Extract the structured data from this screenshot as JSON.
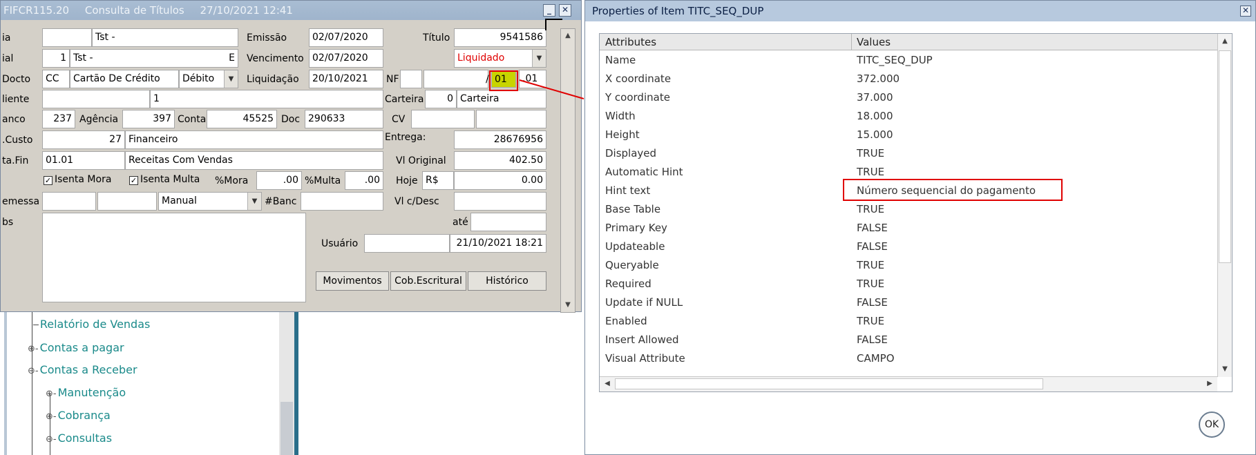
{
  "form": {
    "title_code": "FIFCR115.20",
    "title_name": "Consulta de Títulos",
    "title_datetime": "27/10/2021 12:41",
    "minimize_glyph": "_",
    "close_glyph": "✕",
    "labels": {
      "empresa": "ia",
      "filial": "ial",
      "docto": "Docto",
      "cliente": "liente",
      "banco": "anco",
      "ccusto": ".Custo",
      "contafin": "ta.Fin",
      "remessa": "emessa",
      "obs": "bs",
      "emissao": "Emissão",
      "vencimento": "Vencimento",
      "liquidacao": "Liquidação",
      "titulo": "Título",
      "nf": "NF",
      "carteira": "Carteira",
      "cv": "CV",
      "entrega": "Entrega:",
      "vl_original": "Vl Original",
      "hoje": "Hoje",
      "vl_cdesc": "Vl c/Desc",
      "ate": "até",
      "usuario": "Usuário",
      "agencia": "Agência",
      "conta": "Conta",
      "doc": "Doc",
      "pct_mora": "%Mora",
      "pct_multa": "%Multa",
      "banc": "#Banc",
      "slash": "/"
    },
    "values": {
      "empresa_name": "Tst -",
      "empresa_e": "E",
      "filial_num": "1",
      "filial_name": "Tst -",
      "filial_e": "E",
      "docto_code": "CC",
      "docto_name": "Cartão De Crédito",
      "docto_type": "Débito",
      "cliente_extra": "1",
      "banco_num": "237",
      "agencia_num": "397",
      "conta_num": "45525",
      "doc_num": "290633",
      "ccusto_num": "27",
      "ccusto_name": "Financeiro",
      "contafin_code": "01.01",
      "contafin_name": "Receitas Com Vendas",
      "emissao": "02/07/2020",
      "vencimento": "02/07/2020",
      "liquidacao": "20/10/2021",
      "titulo": "9541586",
      "status": "Liquidado",
      "seq": "01",
      "seq2": ".01",
      "carteira_num": "0",
      "carteira_name": "Carteira",
      "entrega": "28676956",
      "vl_original": "402.50",
      "hoje_currency": "R$",
      "hoje_value": "0.00",
      "mora": ".00",
      "multa": ".00",
      "remessa_type": "Manual",
      "usuario_date": "21/10/2021 18:21"
    },
    "checkboxes": {
      "isenta_mora": "Isenta Mora",
      "isenta_multa": "Isenta Multa"
    },
    "buttons": {
      "movimentos": "Movimentos",
      "cob_escritural": "Cob.Escritural",
      "historico": "Histórico"
    }
  },
  "tree": {
    "items": [
      {
        "label": "Relatório de Vendas"
      },
      {
        "label": "Contas a pagar"
      },
      {
        "label": "Contas a Receber"
      },
      {
        "label": "Manutenção"
      },
      {
        "label": "Cobrança"
      },
      {
        "label": "Consultas"
      }
    ]
  },
  "props": {
    "title": "Properties of Item TITC_SEQ_DUP",
    "close_glyph": "✕",
    "col_attributes": "Attributes",
    "col_values": "Values",
    "rows": [
      {
        "a": "Name",
        "v": "TITC_SEQ_DUP"
      },
      {
        "a": "X coordinate",
        "v": "372.000"
      },
      {
        "a": "Y coordinate",
        "v": "37.000"
      },
      {
        "a": "Width",
        "v": "18.000"
      },
      {
        "a": "Height",
        "v": "15.000"
      },
      {
        "a": "Displayed",
        "v": "TRUE"
      },
      {
        "a": "Automatic Hint",
        "v": "TRUE"
      },
      {
        "a": "Hint text",
        "v": "Número sequencial do pagamento"
      },
      {
        "a": "Base Table",
        "v": "TRUE"
      },
      {
        "a": "Primary Key",
        "v": "FALSE"
      },
      {
        "a": "Updateable",
        "v": "FALSE"
      },
      {
        "a": "Queryable",
        "v": "TRUE"
      },
      {
        "a": "Required",
        "v": "TRUE"
      },
      {
        "a": "Update if NULL",
        "v": "FALSE"
      },
      {
        "a": "Enabled",
        "v": "TRUE"
      },
      {
        "a": "Insert Allowed",
        "v": "FALSE"
      },
      {
        "a": "Visual Attribute",
        "v": "CAMPO"
      }
    ],
    "ok_label": "OK",
    "accent_red": "#e00000"
  }
}
